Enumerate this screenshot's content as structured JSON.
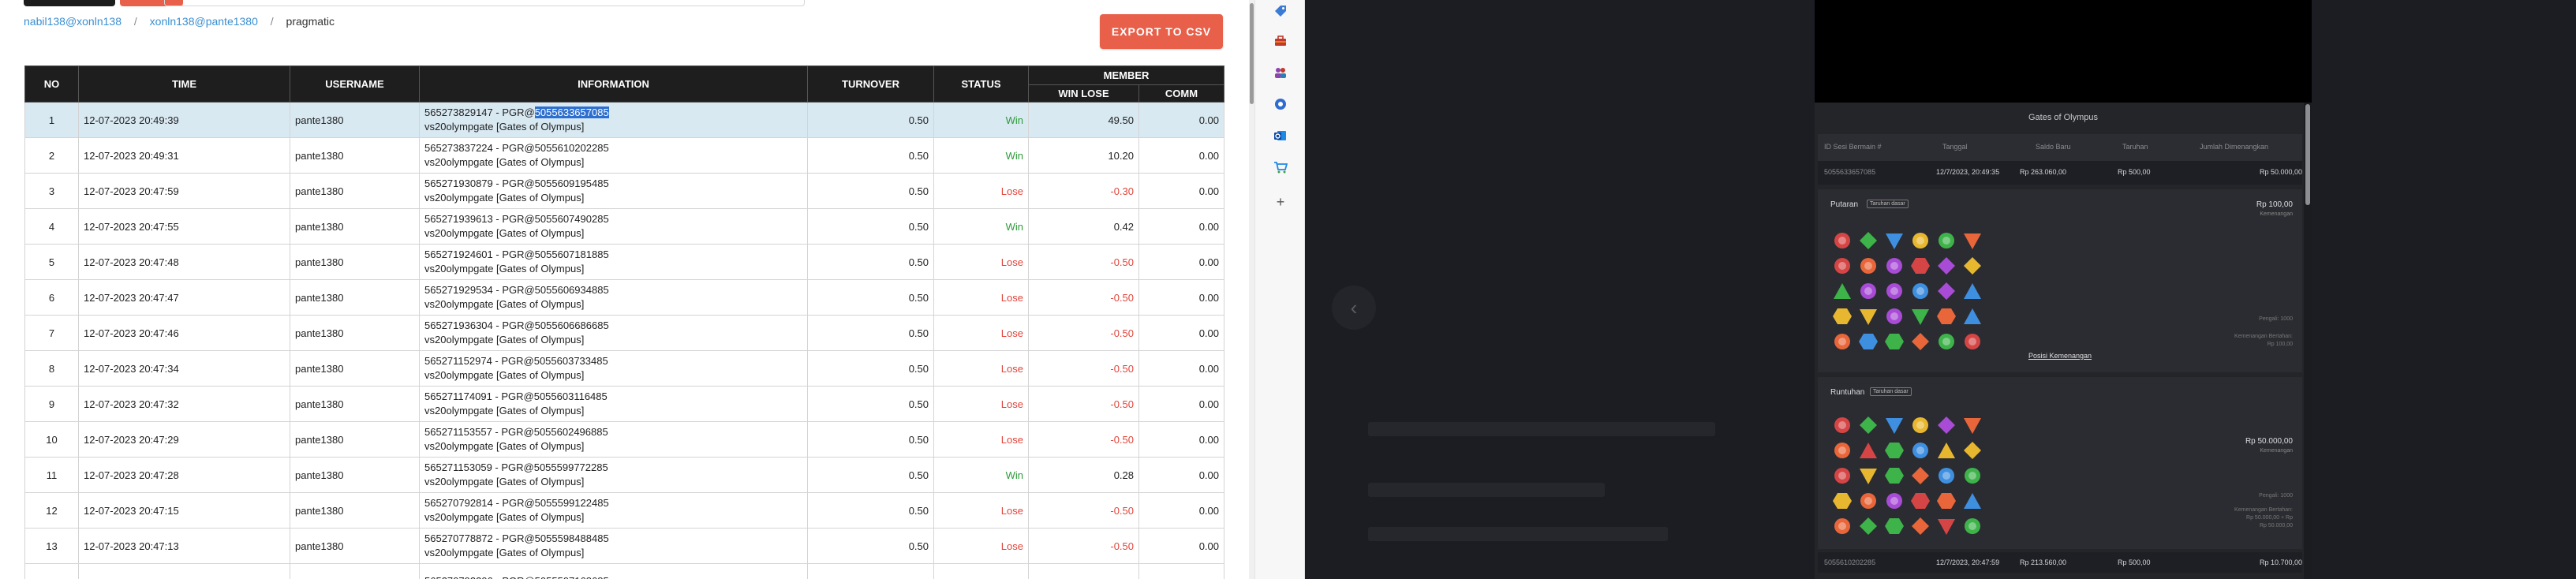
{
  "breadcrumb": {
    "items": [
      "nabil138@xonln138",
      "xonln138@pante1380"
    ],
    "current": "pragmatic",
    "separator": "/"
  },
  "export_button": {
    "label": "EXPORT TO CSV"
  },
  "table": {
    "headers": {
      "no": "NO",
      "time": "TIME",
      "username": "USERNAME",
      "information": "INFORMATION",
      "turnover": "TURNOVER",
      "status": "STATUS",
      "member": "MEMBER",
      "win_lose": "WIN LOSE",
      "comm": "COMM"
    },
    "rows": [
      {
        "no": "1",
        "time": "12-07-2023 20:49:39",
        "user": "pante1380",
        "info_pre": "565273829147 - PGR@",
        "info_hl": "5055633657085",
        "info_line2": "vs20olympgate [Gates of Olympus]",
        "turnover": "0.50",
        "status": "Win",
        "winlose": "49.50",
        "comm": "0.00"
      },
      {
        "no": "2",
        "time": "12-07-2023 20:49:31",
        "user": "pante1380",
        "info_pre": "565273837224 - PGR@5055610202285",
        "info_hl": "",
        "info_line2": "vs20olympgate [Gates of Olympus]",
        "turnover": "0.50",
        "status": "Win",
        "winlose": "10.20",
        "comm": "0.00"
      },
      {
        "no": "3",
        "time": "12-07-2023 20:47:59",
        "user": "pante1380",
        "info_pre": "565271930879 - PGR@5055609195485",
        "info_hl": "",
        "info_line2": "vs20olympgate [Gates of Olympus]",
        "turnover": "0.50",
        "status": "Lose",
        "winlose": "-0.30",
        "comm": "0.00"
      },
      {
        "no": "4",
        "time": "12-07-2023 20:47:55",
        "user": "pante1380",
        "info_pre": "565271939613 - PGR@5055607490285",
        "info_hl": "",
        "info_line2": "vs20olympgate [Gates of Olympus]",
        "turnover": "0.50",
        "status": "Win",
        "winlose": "0.42",
        "comm": "0.00"
      },
      {
        "no": "5",
        "time": "12-07-2023 20:47:48",
        "user": "pante1380",
        "info_pre": "565271924601 - PGR@5055607181885",
        "info_hl": "",
        "info_line2": "vs20olympgate [Gates of Olympus]",
        "turnover": "0.50",
        "status": "Lose",
        "winlose": "-0.50",
        "comm": "0.00"
      },
      {
        "no": "6",
        "time": "12-07-2023 20:47:47",
        "user": "pante1380",
        "info_pre": "565271929534 - PGR@5055606934885",
        "info_hl": "",
        "info_line2": "vs20olympgate [Gates of Olympus]",
        "turnover": "0.50",
        "status": "Lose",
        "winlose": "-0.50",
        "comm": "0.00"
      },
      {
        "no": "7",
        "time": "12-07-2023 20:47:46",
        "user": "pante1380",
        "info_pre": "565271936304 - PGR@5055606686685",
        "info_hl": "",
        "info_line2": "vs20olympgate [Gates of Olympus]",
        "turnover": "0.50",
        "status": "Lose",
        "winlose": "-0.50",
        "comm": "0.00"
      },
      {
        "no": "8",
        "time": "12-07-2023 20:47:34",
        "user": "pante1380",
        "info_pre": "565271152974 - PGR@5055603733485",
        "info_hl": "",
        "info_line2": "vs20olympgate [Gates of Olympus]",
        "turnover": "0.50",
        "status": "Lose",
        "winlose": "-0.50",
        "comm": "0.00"
      },
      {
        "no": "9",
        "time": "12-07-2023 20:47:32",
        "user": "pante1380",
        "info_pre": "565271174091 - PGR@5055603116485",
        "info_hl": "",
        "info_line2": "vs20olympgate [Gates of Olympus]",
        "turnover": "0.50",
        "status": "Lose",
        "winlose": "-0.50",
        "comm": "0.00"
      },
      {
        "no": "10",
        "time": "12-07-2023 20:47:29",
        "user": "pante1380",
        "info_pre": "565271153557 - PGR@5055602496885",
        "info_hl": "",
        "info_line2": "vs20olympgate [Gates of Olympus]",
        "turnover": "0.50",
        "status": "Lose",
        "winlose": "-0.50",
        "comm": "0.00"
      },
      {
        "no": "11",
        "time": "12-07-2023 20:47:28",
        "user": "pante1380",
        "info_pre": "565271153059 - PGR@5055599772285",
        "info_hl": "",
        "info_line2": "vs20olympgate [Gates of Olympus]",
        "turnover": "0.50",
        "status": "Win",
        "winlose": "0.28",
        "comm": "0.00"
      },
      {
        "no": "12",
        "time": "12-07-2023 20:47:15",
        "user": "pante1380",
        "info_pre": "565270792814 - PGR@5055599122485",
        "info_hl": "",
        "info_line2": "vs20olympgate [Gates of Olympus]",
        "turnover": "0.50",
        "status": "Lose",
        "winlose": "-0.50",
        "comm": "0.00"
      },
      {
        "no": "13",
        "time": "12-07-2023 20:47:13",
        "user": "pante1380",
        "info_pre": "565270778872 - PGR@5055598488485",
        "info_hl": "",
        "info_line2": "vs20olympgate [Gates of Olympus]",
        "turnover": "0.50",
        "status": "Lose",
        "winlose": "-0.50",
        "comm": "0.00"
      },
      {
        "no": "",
        "time": "",
        "user": "",
        "info_pre": "565270793306 - PGR@5055597168685",
        "info_hl": "",
        "info_line2": "",
        "turnover": "",
        "status": "",
        "winlose": "",
        "comm": ""
      }
    ]
  },
  "icon_bar": {
    "icons": [
      "tag-icon",
      "toolbox-icon",
      "people-icon",
      "gear-circle-icon",
      "outlook-icon",
      "cart-icon",
      "plus-icon"
    ]
  },
  "game_panel": {
    "title": "Gates of Olympus",
    "headers": [
      "ID Sesi Bermain #",
      "Tanggal",
      "Saldo Baru",
      "Taruhan",
      "Jumlah Dimenangkan"
    ],
    "row1": [
      "5055633657085",
      "12/7/2023, 20:49:35",
      "Rp 263.060,00",
      "Rp 500,00",
      "Rp 50.000,00"
    ],
    "card1": {
      "label": "Putaran",
      "tag": "Taruhan dasar",
      "amount": "Rp 100,00",
      "amount_sub": "Kemenangan",
      "note1": "Pengali: 1000",
      "note2": "Kemenangan Bertahan:",
      "note3": "Rp 100,00",
      "link": "Posisi Kemenangan"
    },
    "card2": {
      "label": "Runtuhan",
      "tag": "Taruhan dasar",
      "amount": "Rp 50.000,00",
      "amount_sub": "Kemenangan",
      "note1": "Pengali: 1000",
      "note2": "Kemenangan Bertahan:",
      "note3": "Rp 50.000,00",
      "note4": "Rp 50.000,00 + Rp"
    },
    "bottom_row": [
      "5055610202285",
      "12/7/2023, 20:47:59",
      "Rp 213.560,00",
      "Rp 500,00",
      "Rp 10.700,00"
    ]
  },
  "colors": {
    "accent": "#e8604a",
    "win": "#2e9a3a",
    "lose": "#e0443a",
    "header_bg": "#1e1e1e",
    "selected_row": "#d8e9f2",
    "link": "#3a8fd1"
  }
}
